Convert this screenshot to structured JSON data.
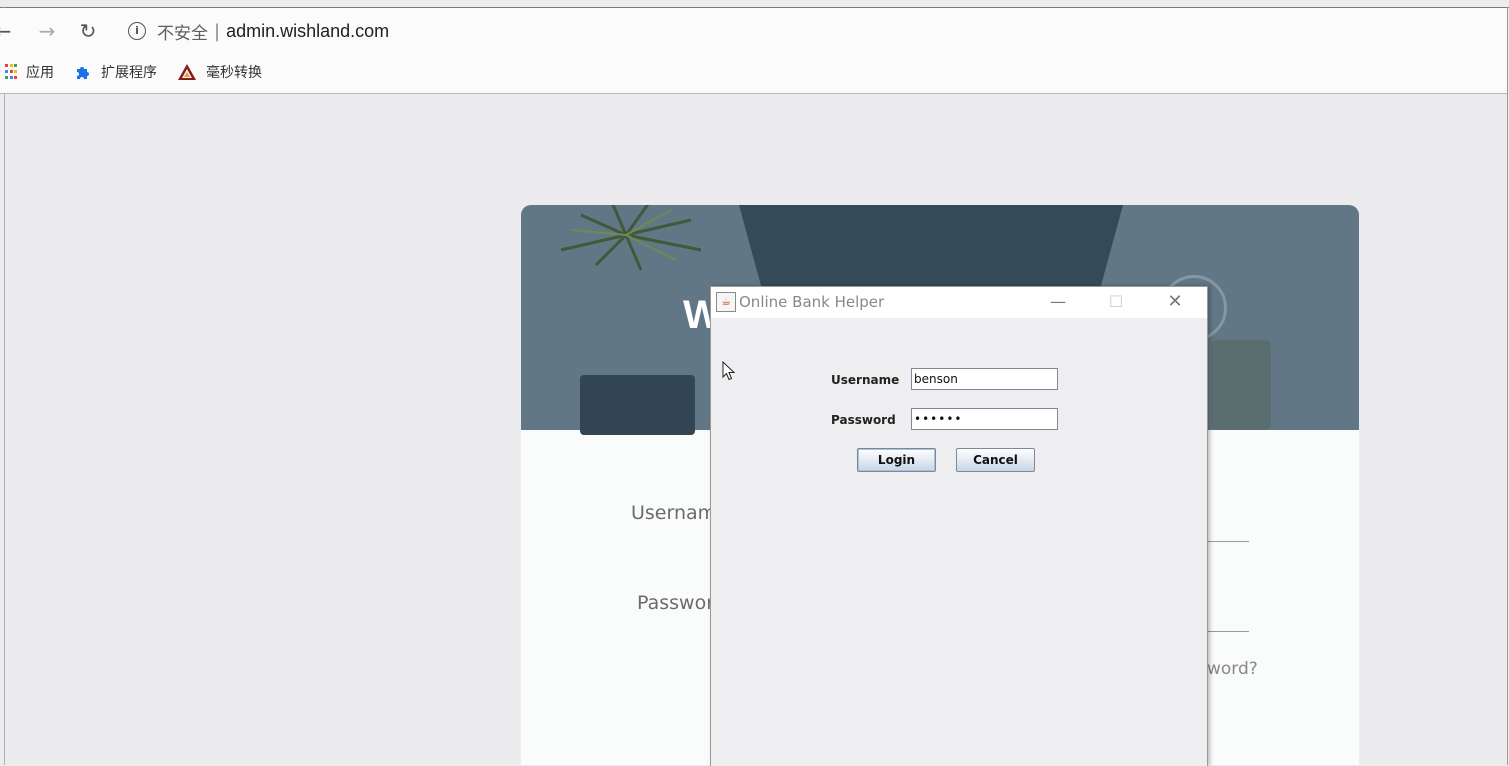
{
  "browser": {
    "security_text": "不安全",
    "separator": "|",
    "url": "admin.wishland.com",
    "bookmarks": [
      {
        "label": "应用",
        "icon": "apps-grid-icon"
      },
      {
        "label": "扩展程序",
        "icon": "puzzle-piece-icon"
      },
      {
        "label": "毫秒转换",
        "icon": "triangle-logo-icon"
      }
    ]
  },
  "web_page": {
    "hero_text": "W",
    "username_label": "Usernam",
    "password_label": "Passwor",
    "forgot_text": "word?"
  },
  "dialog": {
    "title": "Online Bank Helper",
    "username_label": "Username",
    "username_value": "benson",
    "password_label": "Password",
    "password_value": "••••••",
    "login_label": "Login",
    "cancel_label": "Cancel"
  },
  "colors": {
    "page_background": "#ececee",
    "hero_background": "#627786",
    "dialog_background": "#eeeef0"
  }
}
